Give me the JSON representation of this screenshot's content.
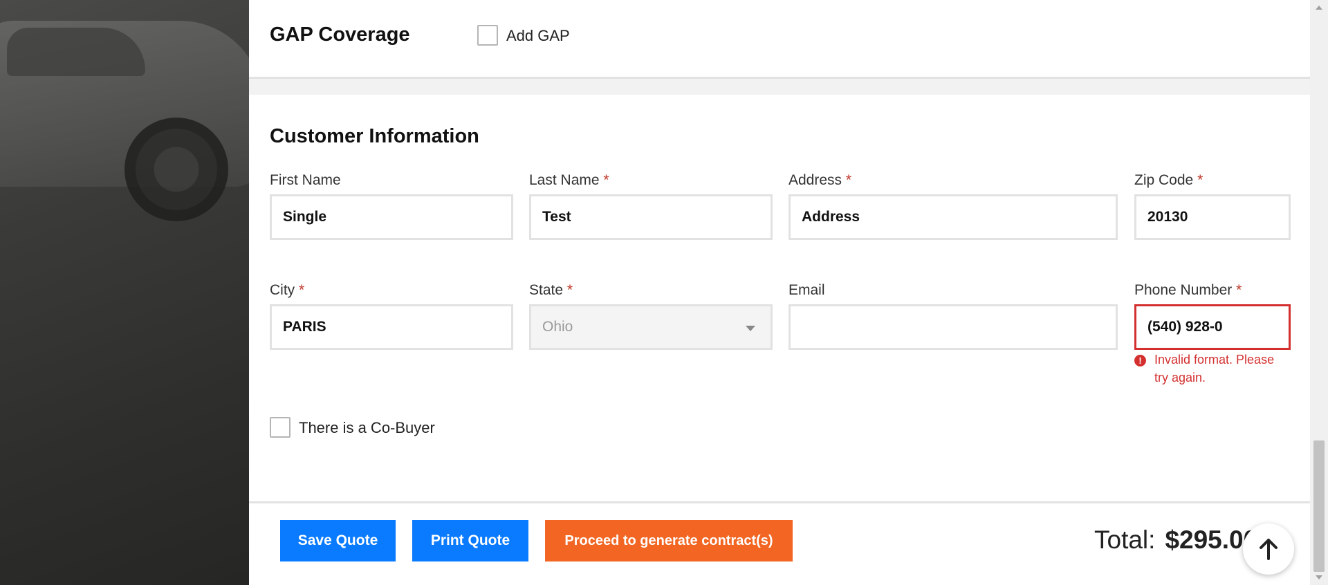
{
  "gap": {
    "title": "GAP Coverage",
    "checkbox_label": "Add GAP"
  },
  "customer": {
    "title": "Customer Information",
    "fields": {
      "first_name": {
        "label": "First Name",
        "value": "Single"
      },
      "last_name": {
        "label": "Last Name",
        "value": "Test",
        "required": "*"
      },
      "address": {
        "label": "Address",
        "value": "Address",
        "required": "*"
      },
      "zip": {
        "label": "Zip Code",
        "value": "20130",
        "required": "*"
      },
      "city": {
        "label": "City",
        "value": "PARIS",
        "required": "*"
      },
      "state": {
        "label": "State",
        "value": "Ohio",
        "required": "*"
      },
      "email": {
        "label": "Email",
        "value": ""
      },
      "phone": {
        "label": "Phone Number",
        "value": "(540) 928-0",
        "required": "*",
        "error_line1": "Invalid format. Please",
        "error_line2": "try again."
      }
    },
    "cobuyer_label": "There is a Co-Buyer"
  },
  "footer": {
    "save_label": "Save Quote",
    "print_label": "Print Quote",
    "proceed_label": "Proceed to generate contract(s)",
    "total_label": "Total:",
    "total_amount": "$295.00"
  },
  "colors": {
    "primary_blue": "#0a7bff",
    "accent_orange": "#f26522",
    "error_red": "#d32f2f"
  },
  "icons": {
    "scroll_top": "arrow-up-icon",
    "error": "exclamation-circle-icon",
    "state_dropdown": "chevron-down-icon"
  }
}
